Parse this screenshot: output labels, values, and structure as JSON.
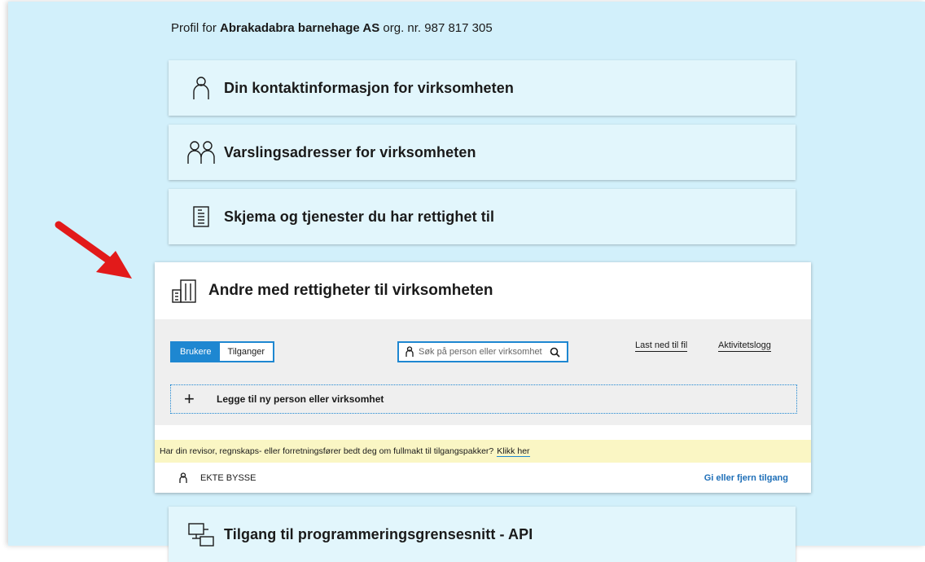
{
  "profile": {
    "prefix": "Profil for",
    "company": "Abrakadabra barnehage AS",
    "org_label": "org. nr.",
    "org_number": "987 817 305"
  },
  "cards": {
    "contact": "Din kontaktinformasjon for virksomheten",
    "notifications": "Varslingsadresser for virksomheten",
    "forms": "Skjema og tjenester du har rettighet til",
    "api": "Tilgang til programmeringsgrensesnitt - API"
  },
  "expanded": {
    "title": "Andre med rettigheter til virksomheten",
    "toggle_users": "Brukere",
    "toggle_access": "Tilganger",
    "search_placeholder": "Søk på person eller virksomhet",
    "download_link": "Last ned til fil",
    "activity_link": "Aktivitetslogg",
    "add_label": "Legge til ny person eller virksomhet",
    "notice_text": "Har din revisor, regnskaps- eller forretningsfører bedt deg om fullmakt til tilgangspakker?",
    "notice_link": "Klikk her",
    "user_name": "EKTE BYSSE",
    "user_action": "Gi eller fjern tilgang"
  },
  "colors": {
    "background": "#d2f0fb",
    "card": "#e2f6fc",
    "accent": "#1e87d1",
    "notice": "#faf6c4",
    "annotation_arrow": "#e21a1a"
  },
  "icons": [
    "person-icon",
    "two-persons-icon",
    "document-icon",
    "building-icon",
    "search-icon",
    "computer-api-icon",
    "red-arrow-annotation"
  ]
}
